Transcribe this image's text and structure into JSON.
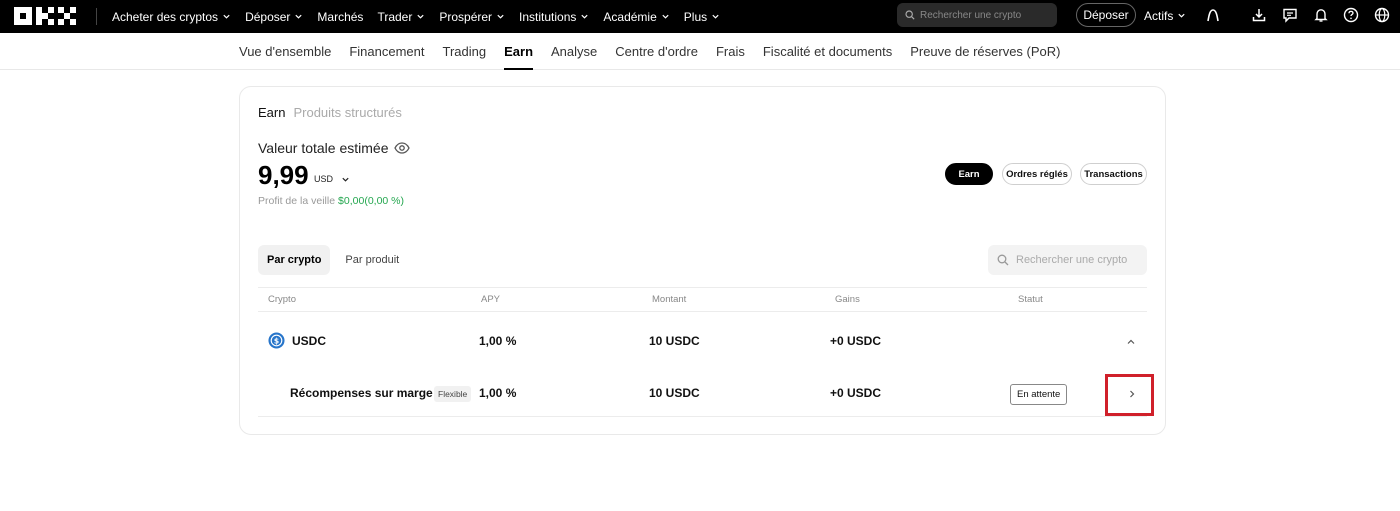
{
  "header": {
    "logo": "OKX",
    "nav": [
      {
        "label": "Acheter des cryptos",
        "has_chevron": true
      },
      {
        "label": "Déposer",
        "has_chevron": true
      },
      {
        "label": "Marchés",
        "has_chevron": false
      },
      {
        "label": "Trader",
        "has_chevron": true
      },
      {
        "label": "Prospérer",
        "has_chevron": true
      },
      {
        "label": "Institutions",
        "has_chevron": true
      },
      {
        "label": "Académie",
        "has_chevron": true
      },
      {
        "label": "Plus",
        "has_chevron": true
      }
    ],
    "search_placeholder": "Rechercher une crypto",
    "deposit_button": "Déposer",
    "assets_menu": "Actifs",
    "icons": [
      "profile-icon",
      "download-icon",
      "chat-icon",
      "bell-icon",
      "help-icon",
      "globe-icon"
    ]
  },
  "subnav": {
    "items": [
      "Vue d'ensemble",
      "Financement",
      "Trading",
      "Earn",
      "Analyse",
      "Centre d'ordre",
      "Frais",
      "Fiscalité et documents",
      "Preuve de réserves (PoR)"
    ],
    "active": "Earn"
  },
  "card": {
    "tabs": {
      "active": "Earn",
      "inactive": "Produits structurés"
    },
    "value_label": "Valeur totale estimée",
    "total_value": "9,99",
    "currency": "USD",
    "profit_label": "Profit de la veille",
    "profit_value": "$0,00(0,00 %)",
    "buttons": {
      "earn": "Earn",
      "settled": "Ordres réglés",
      "transactions": "Transactions"
    },
    "segments": {
      "by_crypto": "Par crypto",
      "by_product": "Par produit"
    },
    "search_placeholder": "Rechercher une crypto",
    "table": {
      "headers": {
        "crypto": "Crypto",
        "apy": "APY",
        "amount": "Montant",
        "gains": "Gains",
        "status": "Statut"
      },
      "asset_row": {
        "coin": "USDC",
        "apy": "1,00 %",
        "amount": "10 USDC",
        "gains": "+0 USDC"
      },
      "product_row": {
        "name": "Récompenses sur marge",
        "tag": "Flexible",
        "apy": "1,00 %",
        "amount": "10 USDC",
        "gains": "+0 USDC",
        "status": "En attente"
      }
    }
  },
  "colors": {
    "accent_green": "#25a750",
    "usdc_blue": "#2775ca",
    "highlight_red": "#d0202a"
  }
}
